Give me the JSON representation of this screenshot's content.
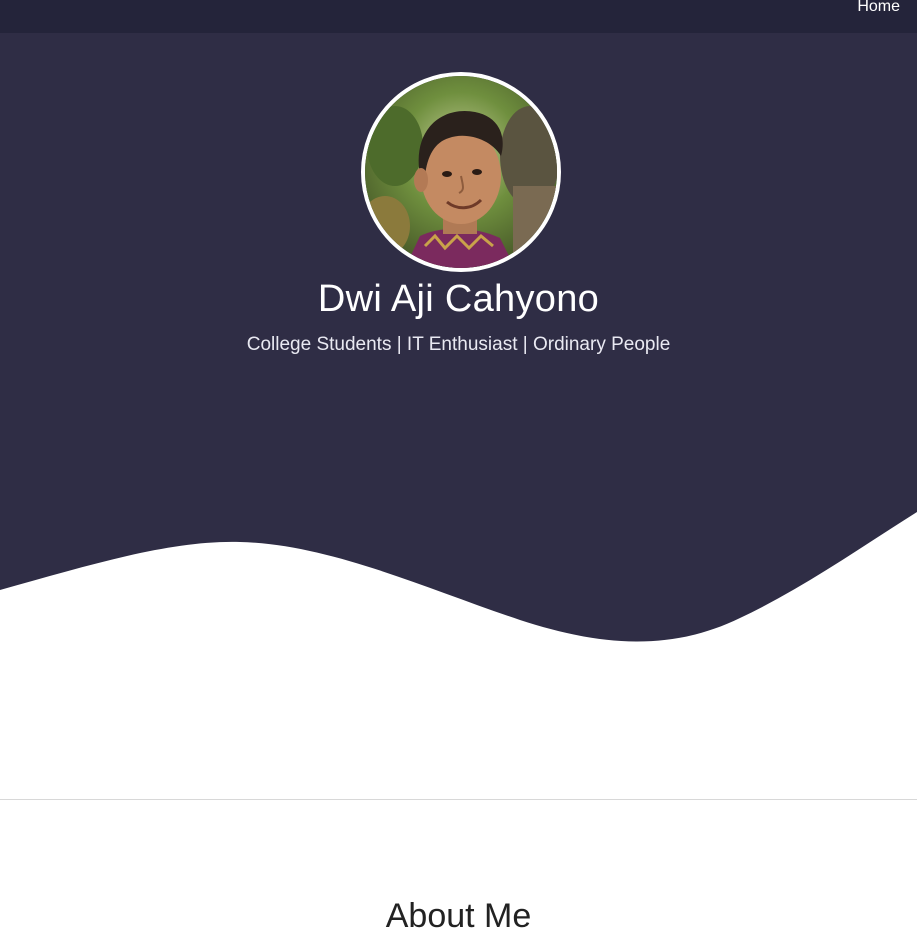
{
  "nav": {
    "items": [
      {
        "label": "Home"
      }
    ]
  },
  "hero": {
    "name": "Dwi Aji Cahyono",
    "tagline": "College Students | IT Enthusiast | Ordinary People",
    "avatar_icon": "profile-photo",
    "background_color": "#2f2d45",
    "navbar_color": "#24243a"
  },
  "about": {
    "title": "About Me"
  }
}
